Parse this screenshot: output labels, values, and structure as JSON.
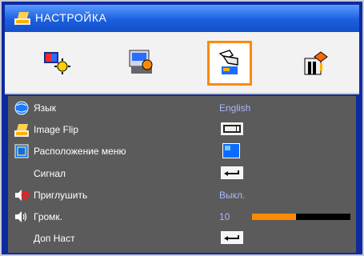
{
  "title": "НАСТРОЙКА",
  "tabs": [
    {
      "name": "image"
    },
    {
      "name": "display"
    },
    {
      "name": "setup",
      "active": true
    },
    {
      "name": "options"
    }
  ],
  "menu": {
    "language": {
      "label": "Язык",
      "value": "English"
    },
    "image_flip": {
      "label": "Image Flip"
    },
    "menu_location": {
      "label": "Расположение меню"
    },
    "signal": {
      "label": "Сигнал"
    },
    "mute": {
      "label": "Приглушить",
      "value": "Выкл."
    },
    "volume": {
      "label": "Громк.",
      "value": "10",
      "level_percent": 45
    },
    "advanced": {
      "label": "Доп Наст"
    }
  }
}
